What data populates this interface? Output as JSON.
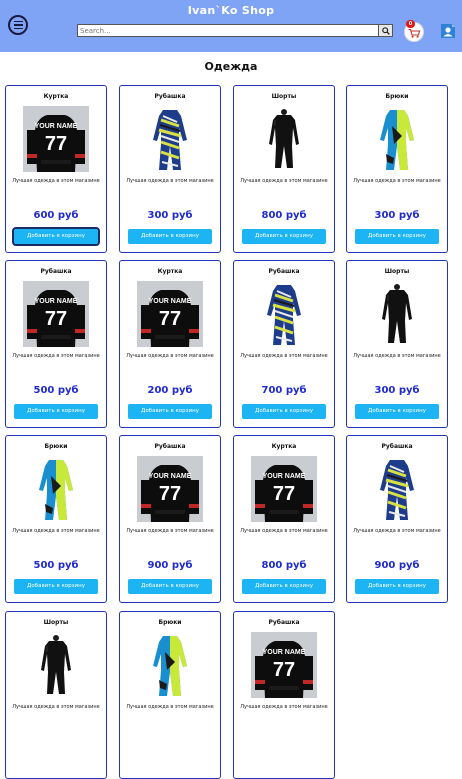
{
  "header": {
    "title": "Ivan`Ko Shop",
    "search_placeholder": "Search...",
    "cart_count": "0",
    "colors": {
      "bar": "#7fa3f5",
      "accent": "#1cb4f2",
      "price": "#1e2ad0"
    }
  },
  "section_title": "Одежда",
  "products": [
    {
      "name": "Куртка",
      "image": "jersey-77",
      "desc": "Лучшая одежда в этом магазине",
      "price": "600 руб",
      "button": "Добавить в корзину"
    },
    {
      "name": "Рубашка",
      "image": "suit-multicolor",
      "desc": "Лучшая одежда в этом магазине",
      "price": "300 руб",
      "button": "Добавить в корзину"
    },
    {
      "name": "Шорты",
      "image": "suit-black",
      "desc": "Лучшая одежда в этом магазине",
      "price": "800 руб",
      "button": "Добавить в корзину"
    },
    {
      "name": "Брюки",
      "image": "suit-blue-lime",
      "desc": "Лучшая одежда в этом магазине",
      "price": "300 руб",
      "button": "Добавить в корзину"
    },
    {
      "name": "Рубашка",
      "image": "jersey-77",
      "desc": "Лучшая одежда в этом магазине",
      "price": "500 руб",
      "button": "Добавить в корзину"
    },
    {
      "name": "Куртка",
      "image": "jersey-77",
      "desc": "Лучшая одежда в этом магазине",
      "price": "200 руб",
      "button": "Добавить в корзину"
    },
    {
      "name": "Рубашка",
      "image": "suit-multicolor",
      "desc": "Лучшая одежда в этом магазине",
      "price": "700 руб",
      "button": "Добавить в корзину"
    },
    {
      "name": "Шорты",
      "image": "suit-black",
      "desc": "Лучшая одежда в этом магазине",
      "price": "300 руб",
      "button": "Добавить в корзину"
    },
    {
      "name": "Брюки",
      "image": "suit-blue-lime",
      "desc": "Лучшая одежда в этом магазине",
      "price": "500 руб",
      "button": "Добавить в корзину"
    },
    {
      "name": "Рубашка",
      "image": "jersey-77",
      "desc": "Лучшая одежда в этом магазине",
      "price": "900 руб",
      "button": "Добавить в корзину"
    },
    {
      "name": "Куртка",
      "image": "jersey-77",
      "desc": "Лучшая одежда в этом магазине",
      "price": "800 руб",
      "button": "Добавить в корзину"
    },
    {
      "name": "Рубашка",
      "image": "suit-multicolor",
      "desc": "Лучшая одежда в этом магазине",
      "price": "900 руб",
      "button": "Добавить в корзину"
    },
    {
      "name": "Шорты",
      "image": "suit-black",
      "desc": "Лучшая одежда в этом магазине",
      "price": "",
      "button": ""
    },
    {
      "name": "Брюки",
      "image": "suit-blue-lime",
      "desc": "Лучшая одежда в этом магазине",
      "price": "",
      "button": ""
    },
    {
      "name": "Рубашка",
      "image": "jersey-77",
      "desc": "Лучшая одежда в этом магазине",
      "price": "",
      "button": ""
    }
  ]
}
